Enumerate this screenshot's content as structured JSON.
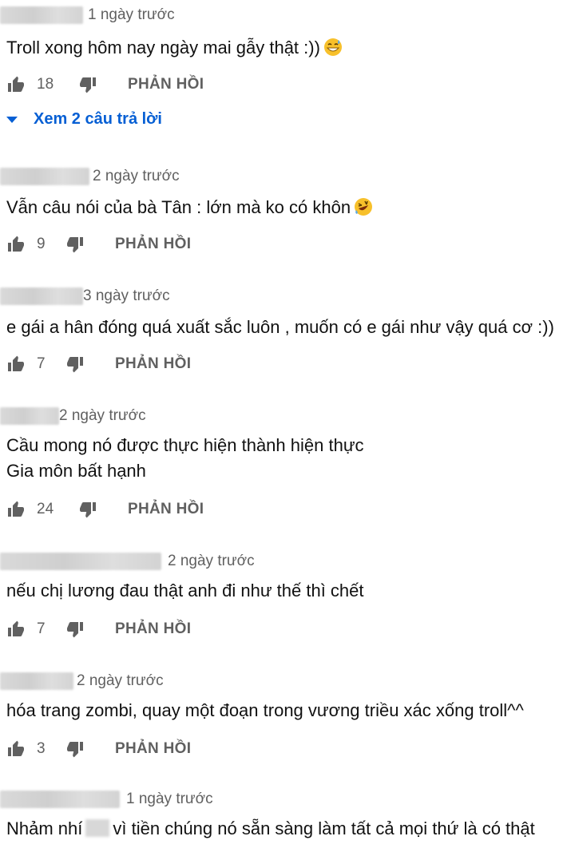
{
  "reply_label": "PHẢN HỒI",
  "comments": [
    {
      "time": "1 ngày trước",
      "lines": [
        "Troll xong hôm nay ngày mai gẫy thật :))"
      ],
      "likes": "18",
      "emoji": "sweat-smile",
      "view_replies": "Xem 2 câu trả lời"
    },
    {
      "time": "2 ngày trước",
      "lines": [
        "Vẫn câu nói của bà Tân : lớn mà ko có khôn"
      ],
      "likes": "9",
      "emoji": "rofl"
    },
    {
      "time": "3 ngày trước",
      "lines": [
        "e gái a hân đóng quá xuất sắc luôn , muốn có e gái như vậy quá cơ :))"
      ],
      "likes": "7"
    },
    {
      "time": "2 ngày trước",
      "lines": [
        "Cầu mong nó được thực hiện thành hiện thực",
        "Gia môn bất hạnh"
      ],
      "likes": "24"
    },
    {
      "time": "2 ngày trước",
      "lines": [
        "nếu chị lương đau thật anh đi như thế thì chết"
      ],
      "likes": "7"
    },
    {
      "time": "2 ngày trước",
      "lines": [
        "hóa trang zombi, quay một đoạn trong vương triều xác xống troll^^"
      ],
      "likes": "3"
    },
    {
      "time": "1 ngày trước",
      "text_a": "Nhảm nhí",
      "text_b": "vì tiền chúng nó sẵn sàng làm tất cả mọi thứ là có thật"
    }
  ],
  "colors": {
    "link": "#065fd4",
    "meta": "#606060",
    "text": "#111111"
  }
}
